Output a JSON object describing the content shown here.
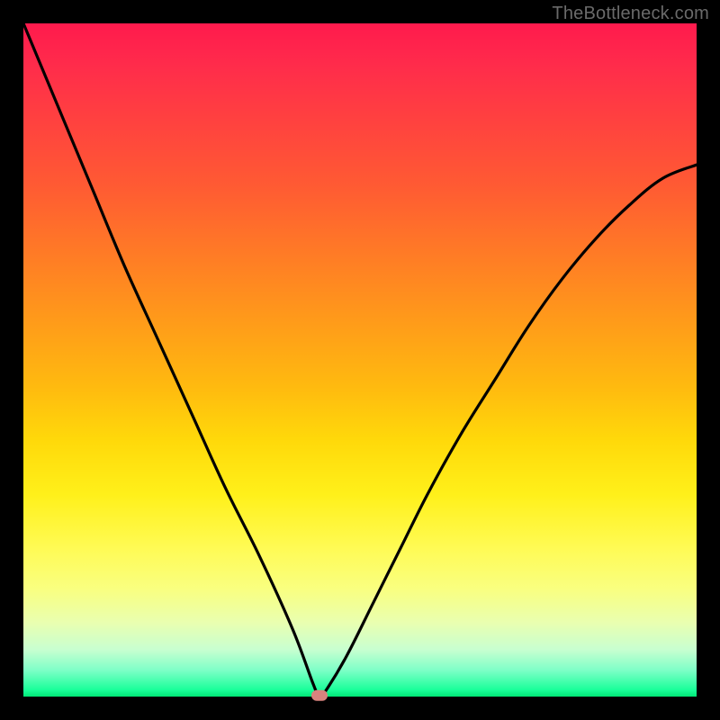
{
  "watermark": "TheBottleneck.com",
  "colors": {
    "background": "#000000",
    "gradient_top": "#ff1a4d",
    "gradient_mid": "#ffd90a",
    "gradient_bottom": "#00e676",
    "curve_stroke": "#000000",
    "marker": "#d9837e",
    "watermark_text": "#6a6a6a"
  },
  "chart_data": {
    "type": "line",
    "title": "",
    "xlabel": "",
    "ylabel": "",
    "xlim": [
      0,
      100
    ],
    "ylim": [
      0,
      100
    ],
    "grid": false,
    "legend": null,
    "notes": "Axes are unlabeled percentages 0–100. Curve is a V-shaped bottleneck profile: steep descent from the left, minimum near x≈44, then a concave rise toward the right.",
    "x": [
      0,
      5,
      10,
      15,
      20,
      25,
      30,
      35,
      40,
      43,
      44,
      45,
      48,
      52,
      56,
      60,
      65,
      70,
      75,
      80,
      85,
      90,
      95,
      100
    ],
    "y": [
      100,
      88,
      76,
      64,
      53,
      42,
      31,
      21,
      10,
      2,
      0,
      1,
      6,
      14,
      22,
      30,
      39,
      47,
      55,
      62,
      68,
      73,
      77,
      79
    ],
    "series": [
      {
        "name": "bottleneck-curve",
        "x_key": "x",
        "y_key": "y"
      }
    ],
    "marker": {
      "x": 44,
      "y": 0,
      "shape": "rounded-rect",
      "color": "#d9837e"
    }
  }
}
